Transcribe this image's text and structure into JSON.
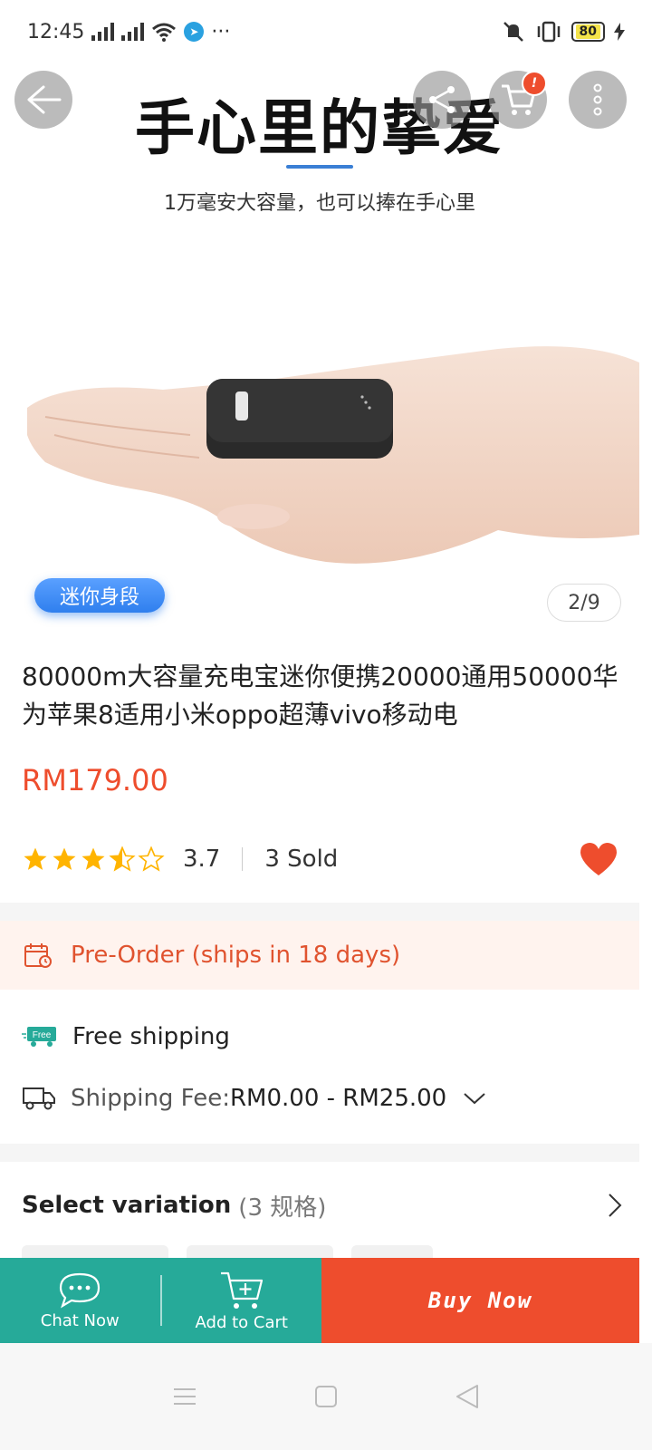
{
  "status_bar": {
    "time": "12:45",
    "battery": "80",
    "more": "···"
  },
  "hero": {
    "headline": "手心里的挚爱",
    "subline": "1万毫安大容量，也可以捧在手心里",
    "badge": "迷你身段",
    "pager": "2/9"
  },
  "nav": {
    "cart_count": "!"
  },
  "product": {
    "title": "80000m大容量充电宝迷你便携20000通用50000华为苹果8适用小米oppo超薄vivo移动电",
    "price": "RM179.00",
    "rating": "3.7",
    "rating_fraction": 0.74,
    "sold": "3 Sold"
  },
  "preorder": {
    "text": "Pre-Order (ships in 18 days)"
  },
  "shipping": {
    "free_label": "Free shipping",
    "free_icon_text": "Free",
    "fee_label": "Shipping Fee: ",
    "fee_value": "RM0.00 - RM25.00"
  },
  "variation": {
    "title": "Select variation",
    "count": "(3 规格)"
  },
  "actions": {
    "chat": "Chat Now",
    "cart": "Add to Cart",
    "buy": "Buy Now"
  },
  "colors": {
    "accent": "#ee4d2d",
    "teal": "#26aa99",
    "preorder_bg": "#fff3ee"
  }
}
